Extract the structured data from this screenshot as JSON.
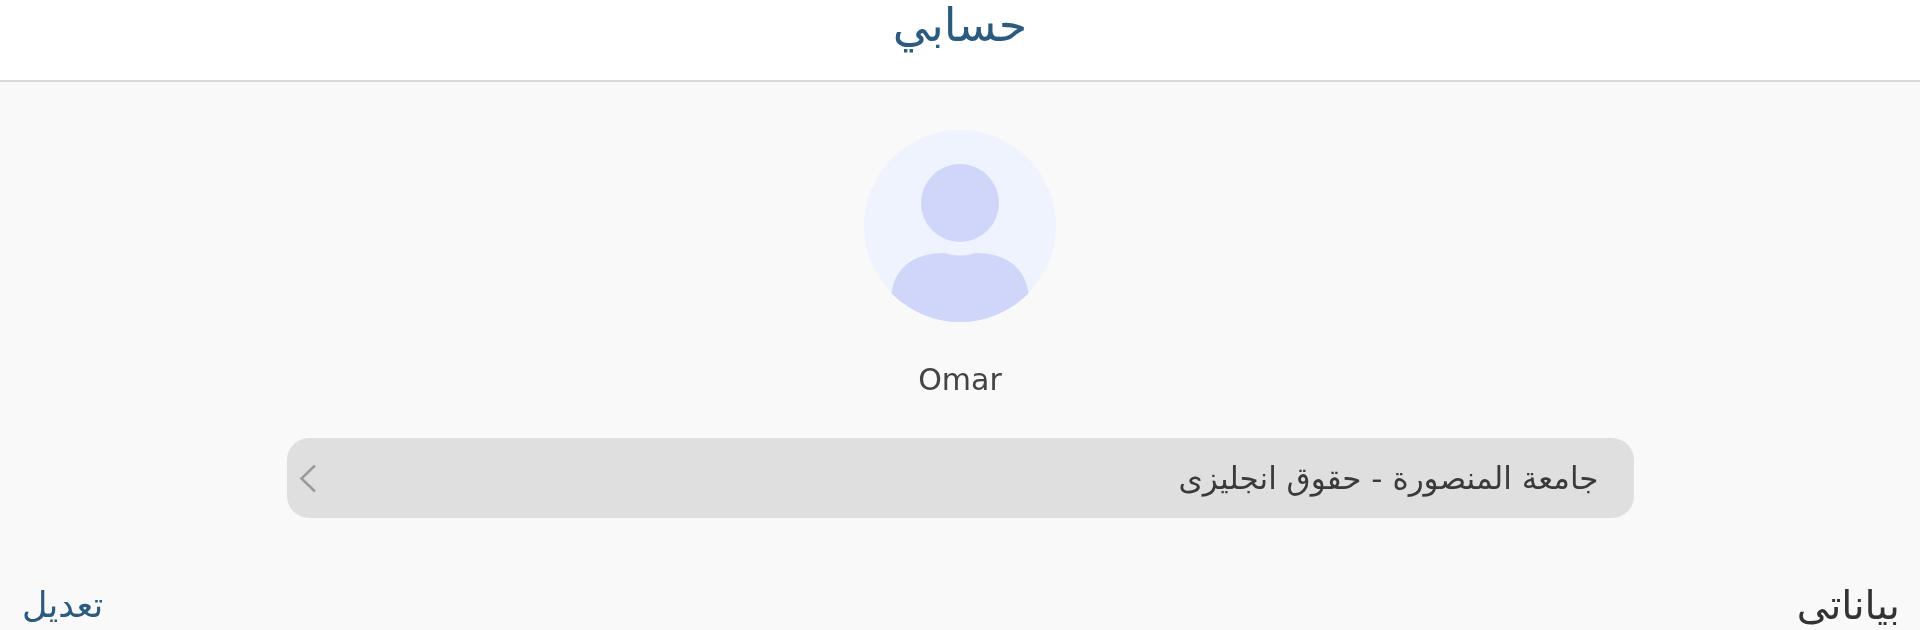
{
  "header": {
    "title": "حسابي"
  },
  "profile": {
    "name": "Omar",
    "university": "جامعة المنصورة - حقوق انجليزى"
  },
  "section": {
    "title": "بياناتى",
    "action": "تعديل"
  }
}
